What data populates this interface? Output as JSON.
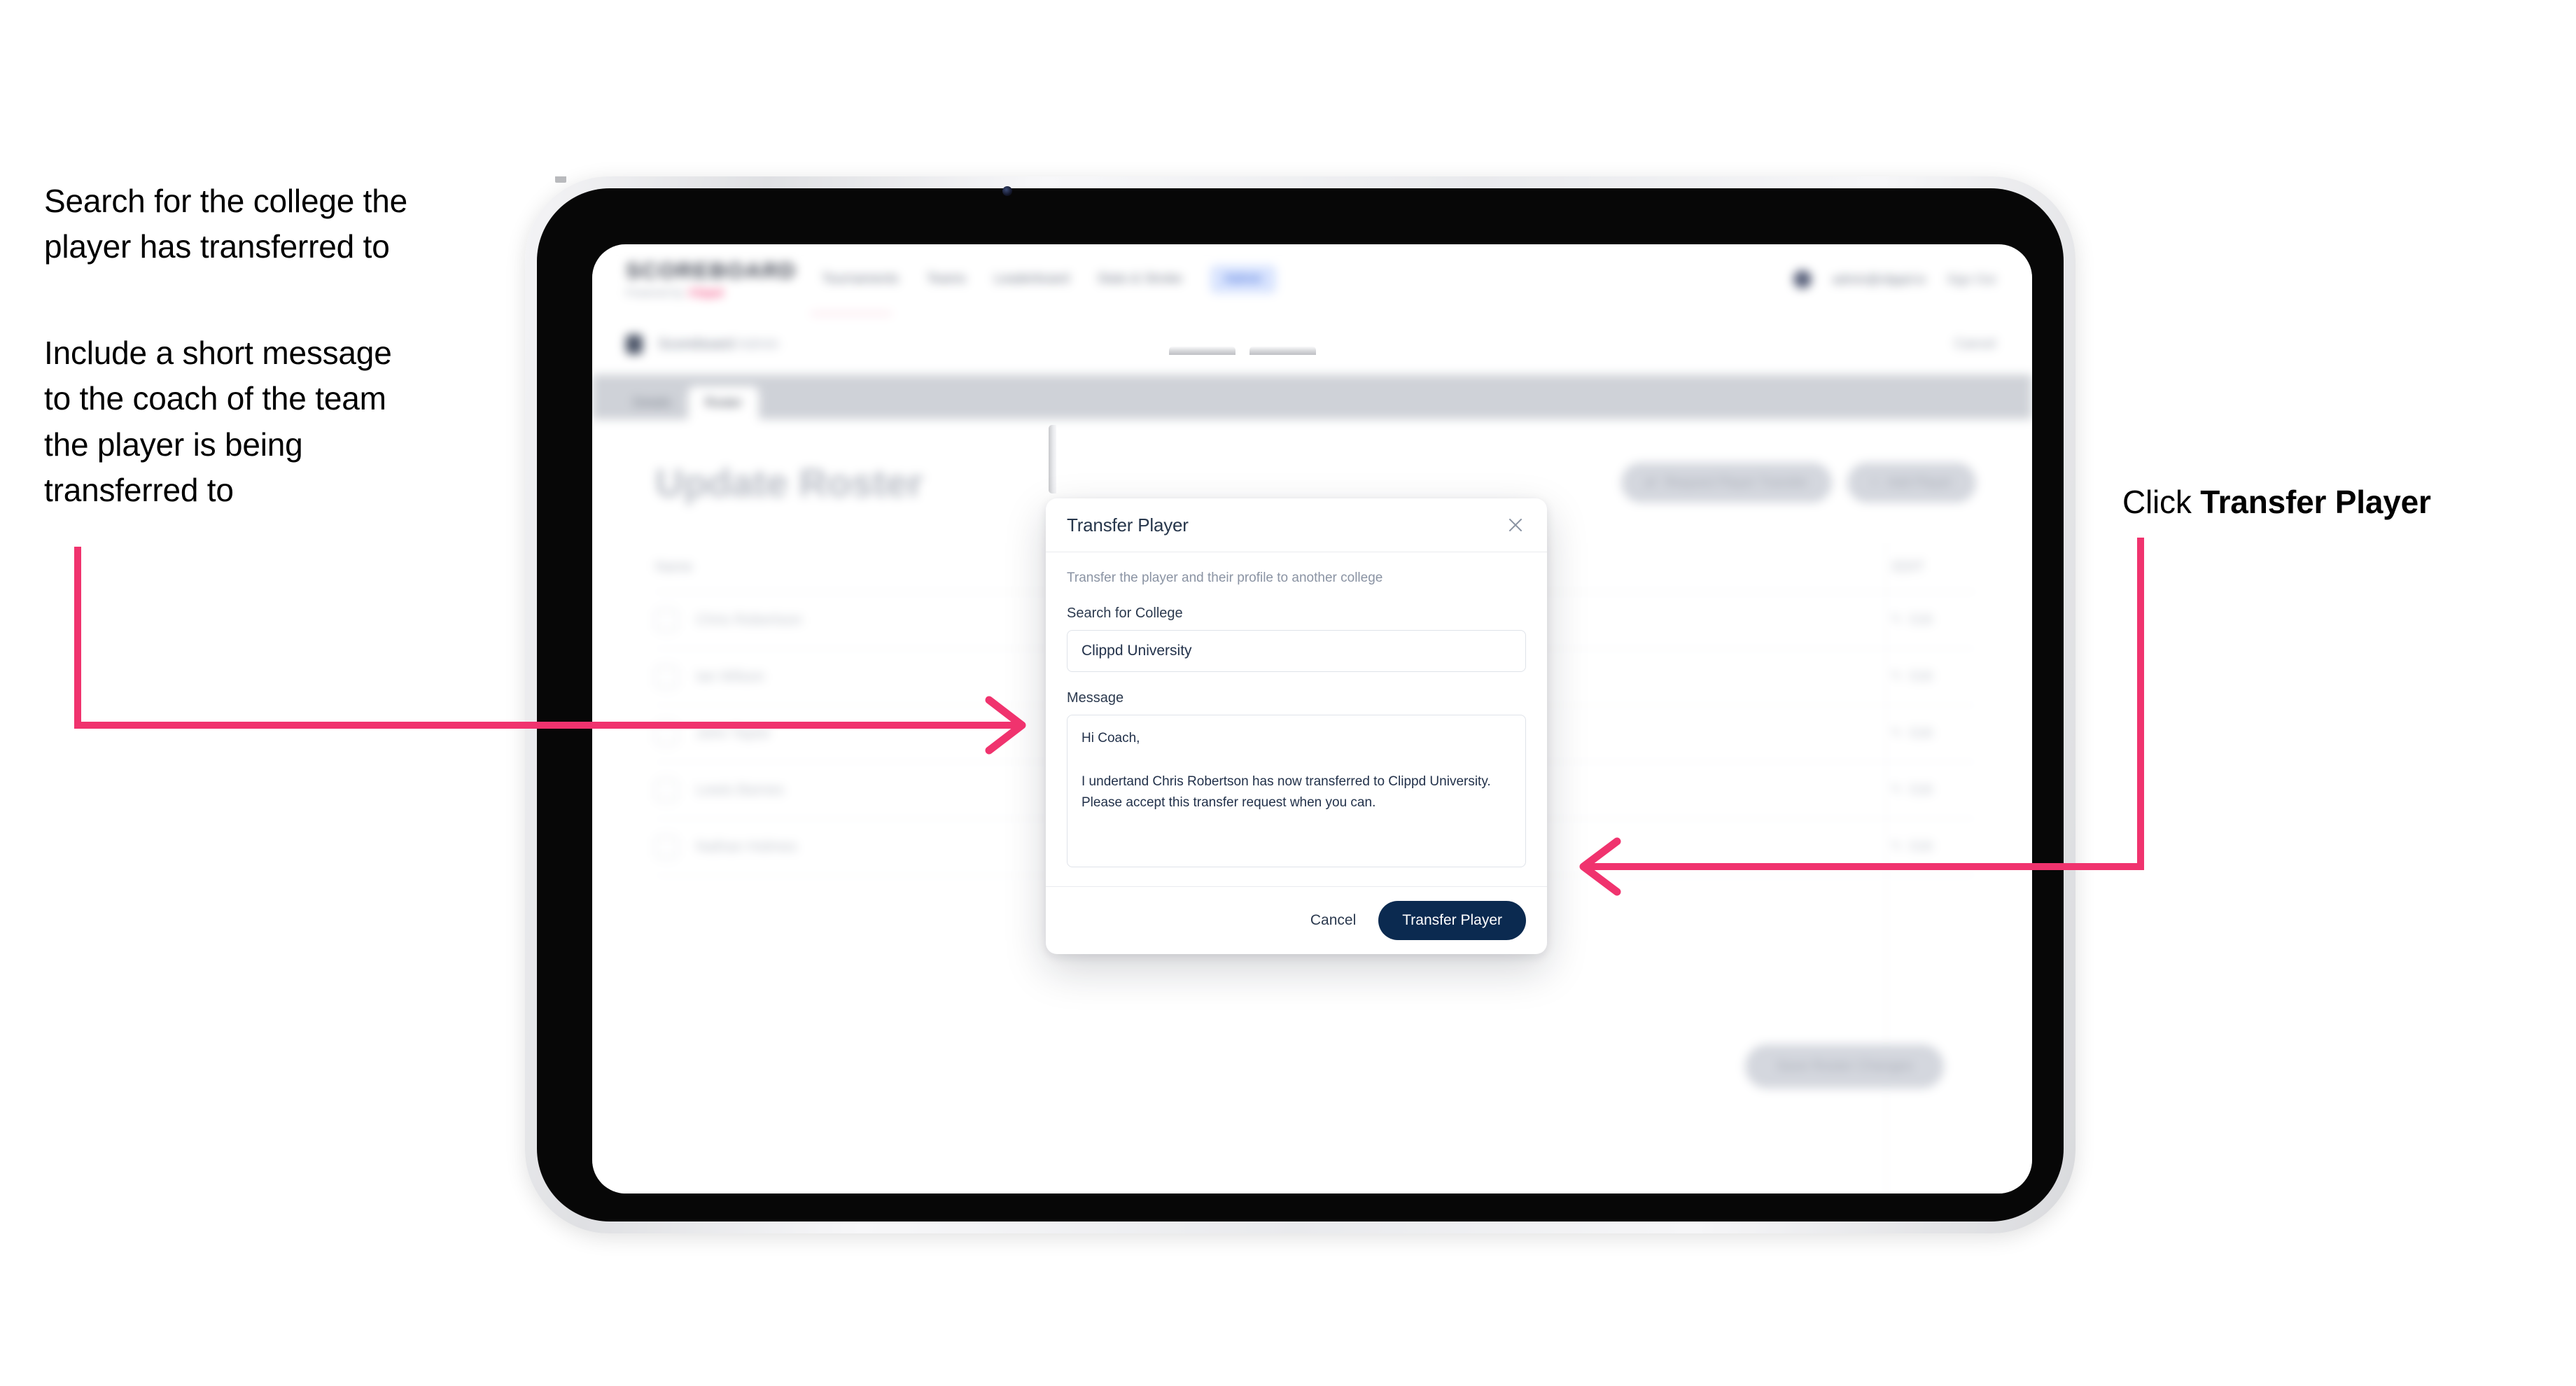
{
  "annotations": {
    "left_note_1": "Search for the college the\nplayer has transferred to",
    "left_note_2": "Include a short message\nto the coach of the team\nthe player is being\ntransferred to",
    "right_note_prefix": "Click ",
    "right_note_bold": "Transfer Player"
  },
  "colors": {
    "arrow": "#F0336E",
    "primary_button": "#0B2A50",
    "nav_active_pill_bg": "#D9E4FE",
    "nav_active_pill_text": "#3663D6",
    "brand_pink": "#F0336E",
    "device_bezel": "#070707"
  },
  "app": {
    "logo": {
      "word": "SCOREBOARD",
      "sub_prefix": "Powered by",
      "sub_brand": "Clippd"
    },
    "nav_links": [
      {
        "label": "Tournaments",
        "active": false
      },
      {
        "label": "Teams",
        "active": false
      },
      {
        "label": "Leaderboard",
        "active": false
      },
      {
        "label": "Stats & Stroke",
        "active": false
      },
      {
        "label": "Admin",
        "active": true
      }
    ],
    "nav_right": {
      "user": "admin@clippd.io",
      "sign_out": "Sign Out"
    },
    "breadcrumb": {
      "title": "Scoreboard",
      "suffix": "Admin",
      "right_action": "Cancel"
    },
    "tabs": [
      {
        "label": "Details",
        "active": false
      },
      {
        "label": "Roster",
        "active": true
      }
    ],
    "page_title": "Update Roster",
    "page_actions": [
      {
        "icon": "arrows-swap-icon",
        "glyph": "⇄",
        "label": "Request Player Transfer"
      },
      {
        "icon": "plus-icon",
        "glyph": "+",
        "label": "Add Player"
      }
    ],
    "roster": {
      "column_name": "Name",
      "column_edit": "EDIT",
      "edit_action_label": "Edit",
      "edit_icon_glyph": "✎",
      "rows": [
        {
          "name": "Chris Robertson"
        },
        {
          "name": "Ian Wilson"
        },
        {
          "name": "John Taylor"
        },
        {
          "name": "Lewis Barnes"
        },
        {
          "name": "Nathan Holmes"
        }
      ]
    },
    "bottom_cta": "Save Roster Changes"
  },
  "modal": {
    "title": "Transfer Player",
    "close_icon": "close-icon",
    "description": "Transfer the player and their profile to another college",
    "college_field": {
      "label": "Search for College",
      "value": "Clippd University",
      "placeholder": "Search for College"
    },
    "message_field": {
      "label": "Message",
      "value": "Hi Coach,\n\nI undertand Chris Robertson has now transferred to Clippd University. Please accept this transfer request when you can.",
      "placeholder": "Message"
    },
    "cancel_label": "Cancel",
    "submit_label": "Transfer Player"
  }
}
